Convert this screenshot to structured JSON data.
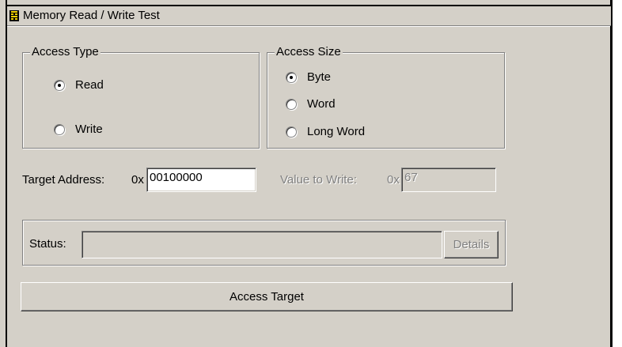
{
  "window": {
    "title": "Memory Read / Write Test"
  },
  "access_type": {
    "legend": "Access Type",
    "options": [
      {
        "label": "Read",
        "checked": true
      },
      {
        "label": "Write",
        "checked": false
      }
    ]
  },
  "access_size": {
    "legend": "Access Size",
    "options": [
      {
        "label": "Byte",
        "checked": true
      },
      {
        "label": "Word",
        "checked": false
      },
      {
        "label": "Long Word",
        "checked": false
      }
    ]
  },
  "target_address": {
    "label": "Target Address:",
    "prefix": "0x",
    "value": "00100000"
  },
  "value_to_write": {
    "label": "Value to Write:",
    "prefix": "0x",
    "value": "67",
    "enabled": false
  },
  "status": {
    "label": "Status:",
    "value": "",
    "details_label": "Details"
  },
  "actions": {
    "access_target_label": "Access Target"
  },
  "colors": {
    "face": "#d4d0c8",
    "shadow": "#808080",
    "highlight": "#ffffff",
    "dark": "#404040"
  },
  "icons": {
    "title_icon": "app-icon"
  }
}
